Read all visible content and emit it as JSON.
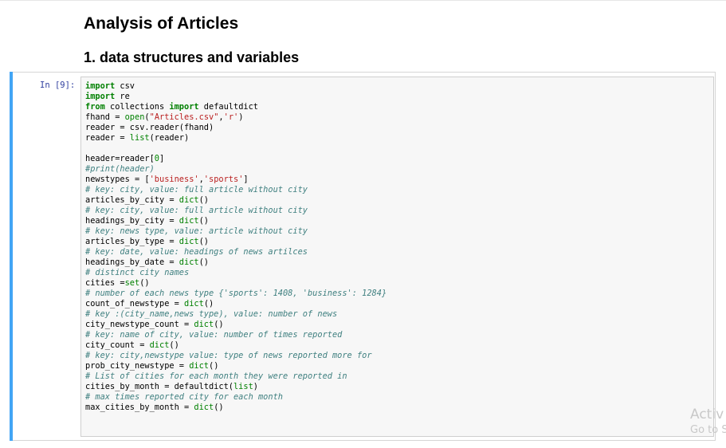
{
  "notebook": {
    "title": "Analysis of Articles",
    "section": "1. data structures and variables",
    "cell": {
      "prompt": "In [9]:",
      "lines": [
        [
          [
            "kw",
            "import"
          ],
          [
            "t",
            " csv"
          ]
        ],
        [
          [
            "kw",
            "import"
          ],
          [
            "t",
            " re"
          ]
        ],
        [
          [
            "kw",
            "from"
          ],
          [
            "t",
            " collections "
          ],
          [
            "kw",
            "import"
          ],
          [
            "t",
            " defaultdict"
          ]
        ],
        [
          [
            "t",
            "fhand = "
          ],
          [
            "bi",
            "open"
          ],
          [
            "t",
            "("
          ],
          [
            "str",
            "\"Articles.csv\""
          ],
          [
            "t",
            ","
          ],
          [
            "str",
            "'r'"
          ],
          [
            "t",
            ")"
          ]
        ],
        [
          [
            "t",
            "reader = csv.reader(fhand)"
          ]
        ],
        [
          [
            "t",
            "reader = "
          ],
          [
            "bi",
            "list"
          ],
          [
            "t",
            "(reader)"
          ]
        ],
        [
          [
            "t",
            ""
          ]
        ],
        [
          [
            "t",
            "header=reader["
          ],
          [
            "num",
            "0"
          ],
          [
            "t",
            "]"
          ]
        ],
        [
          [
            "cm",
            "#print(header)"
          ]
        ],
        [
          [
            "t",
            "newstypes = ["
          ],
          [
            "str",
            "'business'"
          ],
          [
            "t",
            ","
          ],
          [
            "str",
            "'sports'"
          ],
          [
            "t",
            "]"
          ]
        ],
        [
          [
            "cm",
            "# key: city, value: full article without city"
          ]
        ],
        [
          [
            "t",
            "articles_by_city = "
          ],
          [
            "bi",
            "dict"
          ],
          [
            "t",
            "()"
          ]
        ],
        [
          [
            "cm",
            "# key: city, value: full article without city"
          ]
        ],
        [
          [
            "t",
            "headings_by_city = "
          ],
          [
            "bi",
            "dict"
          ],
          [
            "t",
            "()"
          ]
        ],
        [
          [
            "cm",
            "# key: news type, value: article without city"
          ]
        ],
        [
          [
            "t",
            "articles_by_type = "
          ],
          [
            "bi",
            "dict"
          ],
          [
            "t",
            "()"
          ]
        ],
        [
          [
            "cm",
            "# key: date, value: headings of news artilces"
          ]
        ],
        [
          [
            "t",
            "headings_by_date = "
          ],
          [
            "bi",
            "dict"
          ],
          [
            "t",
            "()"
          ]
        ],
        [
          [
            "cm",
            "# distinct city names"
          ]
        ],
        [
          [
            "t",
            "cities ="
          ],
          [
            "bi",
            "set"
          ],
          [
            "t",
            "()"
          ]
        ],
        [
          [
            "cm",
            "# number of each news type {'sports': 1408, 'business': 1284}"
          ]
        ],
        [
          [
            "t",
            "count_of_newstype = "
          ],
          [
            "bi",
            "dict"
          ],
          [
            "t",
            "()"
          ]
        ],
        [
          [
            "cm",
            "# key :(city_name,news type), value: number of news"
          ]
        ],
        [
          [
            "t",
            "city_newstype_count = "
          ],
          [
            "bi",
            "dict"
          ],
          [
            "t",
            "()"
          ]
        ],
        [
          [
            "cm",
            "# key: name of city, value: number of times reported"
          ]
        ],
        [
          [
            "t",
            "city_count = "
          ],
          [
            "bi",
            "dict"
          ],
          [
            "t",
            "()"
          ]
        ],
        [
          [
            "cm",
            "# key: city,newstype value: type of news reported more for"
          ]
        ],
        [
          [
            "t",
            "prob_city_newstype = "
          ],
          [
            "bi",
            "dict"
          ],
          [
            "t",
            "()"
          ]
        ],
        [
          [
            "cm",
            "# List of cities for each month they were reported in"
          ]
        ],
        [
          [
            "t",
            "cities_by_month = defaultdict("
          ],
          [
            "bi",
            "list"
          ],
          [
            "t",
            ")"
          ]
        ],
        [
          [
            "cm",
            "# max times reported city for each month"
          ]
        ],
        [
          [
            "t",
            "max_cities_by_month = "
          ],
          [
            "bi",
            "dict"
          ],
          [
            "t",
            "()"
          ]
        ]
      ]
    }
  },
  "watermark": {
    "line1": "Activ",
    "line2": "Go to S"
  },
  "colors": {
    "cell_bar": "#42a5f5",
    "prompt": "#303f9f",
    "keyword": "#008000",
    "string": "#ba2121",
    "comment": "#408080"
  }
}
